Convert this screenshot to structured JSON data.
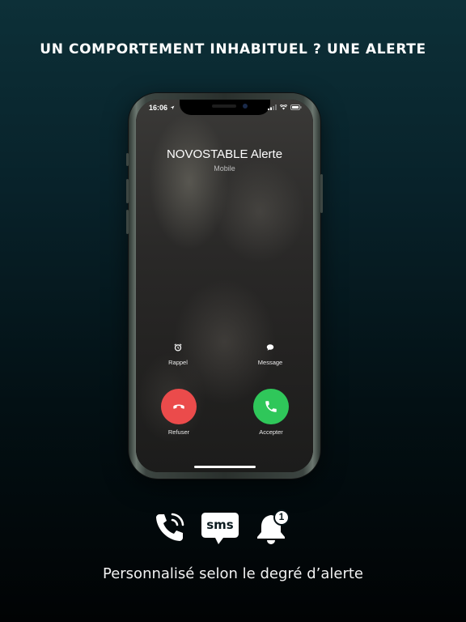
{
  "headline": "UN COMPORTEMENT INHABITUEL ? UNE ALERTE",
  "phone": {
    "status_time": "16:06",
    "caller_name": "NOVOSTABLE Alerte",
    "caller_type": "Mobile",
    "actions": {
      "remind_label": "Rappel",
      "message_label": "Message",
      "decline_label": "Refuser",
      "accept_label": "Accepter"
    },
    "colors": {
      "decline": "#eb4b4b",
      "accept": "#2fc75a"
    }
  },
  "features": {
    "icons": [
      "phone-call-icon",
      "sms-bubble-icon",
      "bell-notification-icon"
    ],
    "sms_text": "sms",
    "badge_count": "1"
  },
  "tagline": "Personnalisé selon le degré d’alerte"
}
